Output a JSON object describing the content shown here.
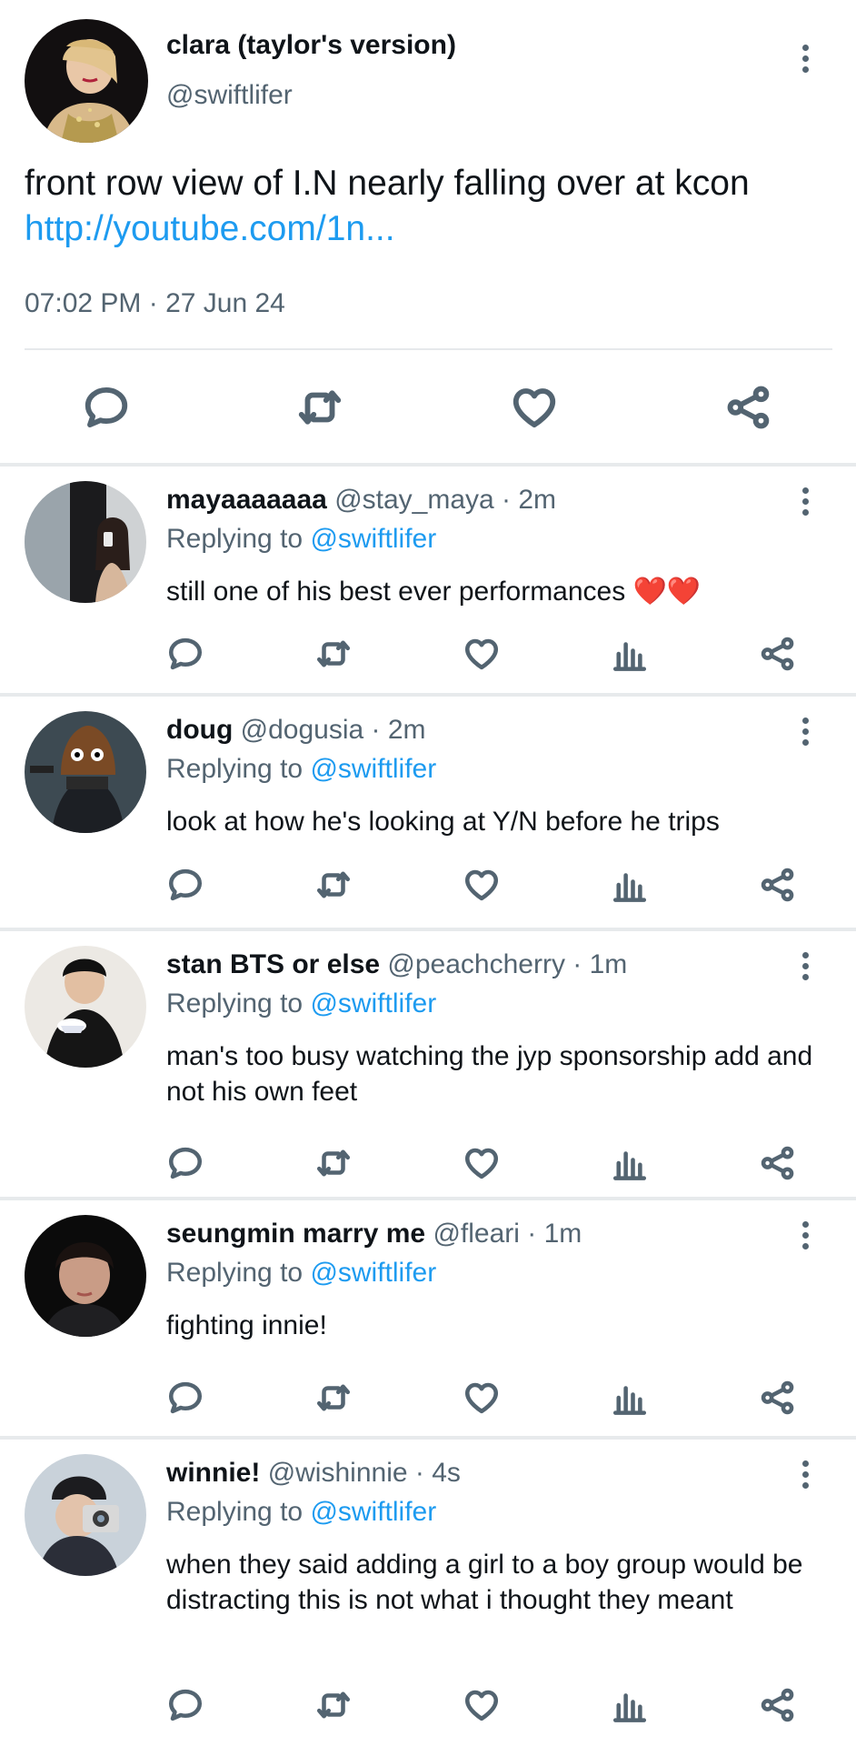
{
  "main_tweet": {
    "name": "clara (taylor's version)",
    "handle": "@swiftlifer",
    "text": "front row view of I.N nearly falling over at kcon",
    "link": "http://youtube.com/1n...",
    "timestamp": "07:02 PM · 27 Jun 24",
    "actions": [
      "reply-icon",
      "retweet-icon",
      "like-icon",
      "share-icon"
    ]
  },
  "replies": [
    {
      "name": "mayaaaaaaa",
      "handle_time": "@stay_maya · 2m",
      "replying_prefix": "Replying to",
      "replying_to": "@swiftlifer",
      "text": "still one of his best ever performances ❤️❤️"
    },
    {
      "name": "doug",
      "handle_time": "@dogusia · 2m",
      "replying_prefix": "Replying to",
      "replying_to": "@swiftlifer",
      "text": "look at how he's looking at Y/N before he trips"
    },
    {
      "name": "stan BTS or else",
      "handle_time": "@peachcherry · 1m",
      "replying_prefix": "Replying to",
      "replying_to": "@swiftlifer",
      "text": "man's too busy watching the jyp sponsorship add and not his own feet"
    },
    {
      "name": "seungmin marry me",
      "handle_time": "@fleari · 1m",
      "replying_prefix": "Replying to",
      "replying_to": "@swiftlifer",
      "text": "fighting innie!"
    },
    {
      "name": "winnie!",
      "handle_time": "@wishinnie · 4s",
      "replying_prefix": "Replying to",
      "replying_to": "@swiftlifer",
      "text": "when they said adding a girl to a boy group would be distracting this is not what i thought they meant"
    }
  ],
  "colors": {
    "link": "#1d9bf0",
    "secondary_text": "#536471",
    "primary_text": "#0f1419"
  }
}
